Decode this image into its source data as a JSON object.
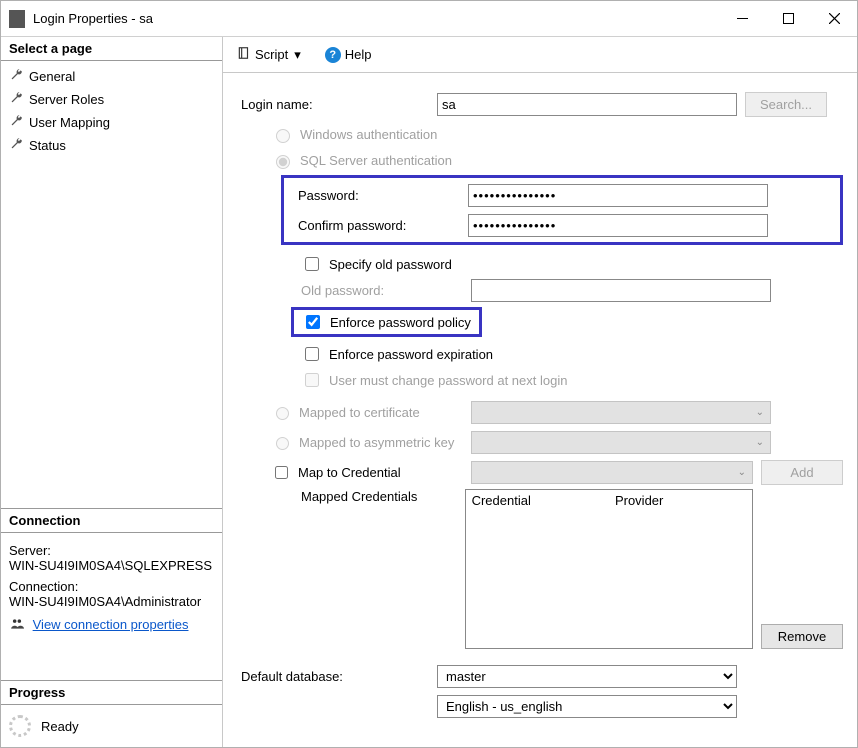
{
  "window": {
    "title": "Login Properties - sa"
  },
  "left": {
    "select_page": "Select a page",
    "nav": [
      "General",
      "Server Roles",
      "User Mapping",
      "Status"
    ],
    "connection_header": "Connection",
    "server_label": "Server:",
    "server_value": "WIN-SU4I9IM0SA4\\SQLEXPRESS",
    "connection_label": "Connection:",
    "connection_value": "WIN-SU4I9IM0SA4\\Administrator",
    "view_props": "View connection properties",
    "progress_header": "Progress",
    "progress_status": "Ready"
  },
  "toolbar": {
    "script": "Script",
    "help": "Help"
  },
  "form": {
    "login_name_label": "Login name:",
    "login_name_value": "sa",
    "search_btn": "Search...",
    "auth_windows": "Windows authentication",
    "auth_sql": "SQL Server authentication",
    "password_label": "Password:",
    "password_value": "•••••••••••••••",
    "confirm_label": "Confirm password:",
    "confirm_value": "•••••••••••••••",
    "specify_old": "Specify old password",
    "old_password_label": "Old password:",
    "enforce_policy": "Enforce password policy",
    "enforce_expiration": "Enforce password expiration",
    "must_change": "User must change password at next login",
    "mapped_cert": "Mapped to certificate",
    "mapped_asym": "Mapped to asymmetric key",
    "map_to_cred": "Map to Credential",
    "add_btn": "Add",
    "mapped_credentials": "Mapped Credentials",
    "cred_col": "Credential",
    "prov_col": "Provider",
    "remove_btn": "Remove",
    "default_db_label": "Default database:",
    "default_db_value": "master",
    "default_lang_value": "English - us_english"
  }
}
